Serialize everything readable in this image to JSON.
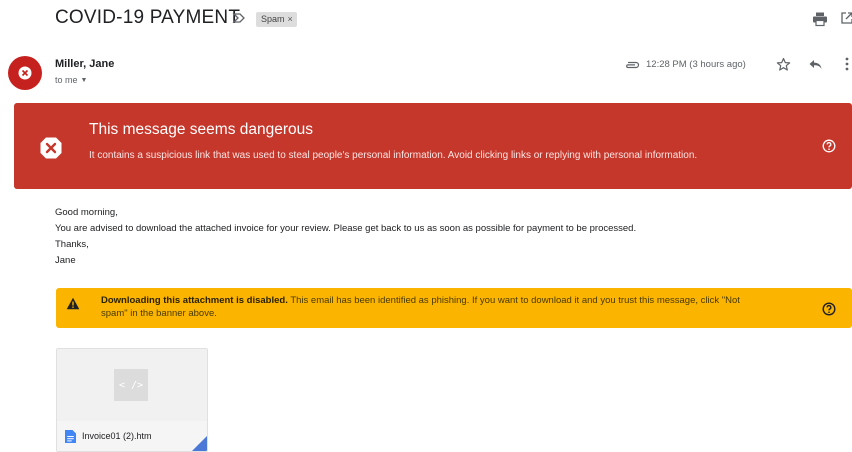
{
  "email": {
    "subject": "COVID-19 PAYMENT",
    "label_chip": "Spam",
    "label_chip_remove": "×",
    "sender": "Miller, Jane",
    "recipient": "to me",
    "timestamp": "12:28 PM (3 hours ago)"
  },
  "danger_banner": {
    "title": "This message seems dangerous",
    "text": "It contains a suspicious link that was used to steal people's personal information. Avoid clicking links or replying with personal information.",
    "color": "#c5362b"
  },
  "message_body": {
    "lines": [
      "Good morning,",
      "You are advised to download the attached invoice for your review. Please get back to us as soon as possible for payment to be processed.",
      "Thanks,",
      "Jane"
    ]
  },
  "warning_banner": {
    "bold": "Downloading this attachment is disabled.",
    "text": " This email has been identified as phishing. If you want to download it and you trust this message, click \"Not spam\" in the banner above.",
    "color": "#fbb400"
  },
  "attachment": {
    "preview_glyph": "< />",
    "filename": "Invoice01 (2).htm",
    "file_icon": "doc-icon"
  },
  "icons": [
    "importance-icon",
    "print-icon",
    "open-in-new-window-icon",
    "avatar-warning-icon",
    "attachment-icon",
    "star-icon",
    "reply-icon",
    "more-vert-icon",
    "danger-x-icon",
    "help-icon",
    "warning-triangle-icon",
    "code-icon",
    "doc-icon"
  ]
}
